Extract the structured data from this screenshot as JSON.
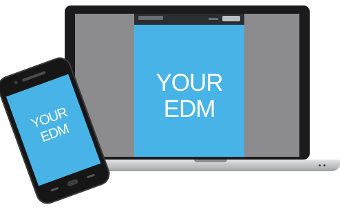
{
  "laptop": {
    "screen_text_line1": "YOUR",
    "screen_text_line2": "EDM"
  },
  "phone": {
    "screen_text_line1": "YOUR",
    "screen_text_line2": "EDM"
  },
  "colors": {
    "screen_blue": "#48b3e6",
    "device_black": "#1b1b1d",
    "laptop_screen_gray": "#8c8c8e",
    "email_header": "#2b2e31"
  }
}
